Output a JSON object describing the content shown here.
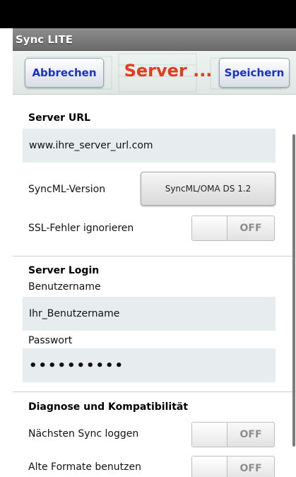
{
  "app": {
    "title": "Sync LITE"
  },
  "toolbar": {
    "cancel_label": "Abbrechen",
    "title": "Server ...",
    "save_label": "Speichern"
  },
  "server": {
    "section_title": "Server URL",
    "url_value": "www.ihre_server_url.com",
    "syncml_label": "SyncML-Version",
    "syncml_value": "SyncML/OMA DS 1.2",
    "ssl_label": "SSL-Fehler ignorieren",
    "ssl_state": "OFF"
  },
  "login": {
    "section_title": "Server Login",
    "username_label": "Benutzername",
    "username_value": "Ihr_Benutzername",
    "password_label": "Passwort",
    "password_value": "••••••••••"
  },
  "diagnose": {
    "section_title": "Diagnose und Kompatibilität",
    "next_sync_label": "Nächsten Sync loggen",
    "next_sync_state": "OFF",
    "old_formats_label": "Alte Formate benutzen",
    "old_formats_state": "OFF"
  },
  "colors": {
    "accent_title": "#e33b1b",
    "button_text": "#1a2fcf",
    "titlebar": "#7a7a7a"
  }
}
